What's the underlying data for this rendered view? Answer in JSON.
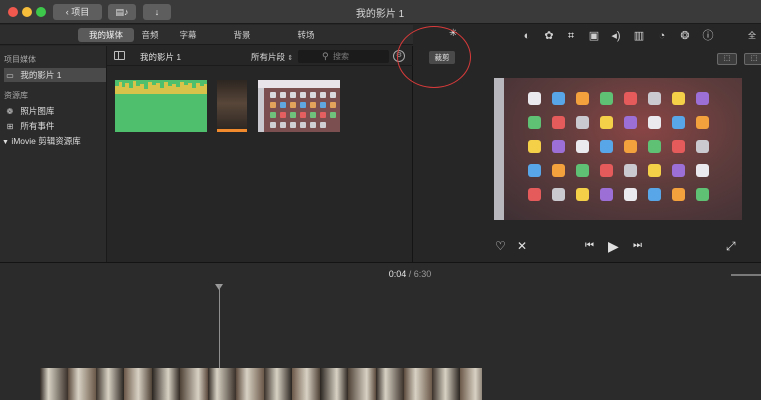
{
  "window": {
    "title": "我的影片 1",
    "back_label": "项目",
    "media_icon": "film-music-icon",
    "import_icon": "down-arrow-icon"
  },
  "tabs": [
    {
      "label": "我的媒体",
      "active": true
    },
    {
      "label": "音频",
      "active": false
    },
    {
      "label": "字幕",
      "active": false
    },
    {
      "label": "背景",
      "active": false
    },
    {
      "label": "转场",
      "active": false
    }
  ],
  "sidebar": {
    "project_header": "项目媒体",
    "project_item": "我的影片 1",
    "library_header": "资源库",
    "library_items": [
      {
        "label": "照片图库",
        "icon": "photos-icon"
      },
      {
        "label": "所有事件",
        "icon": "events-icon"
      }
    ],
    "imovie_library": "iMovie 剪辑资源库"
  },
  "browser": {
    "title": "我的影片 1",
    "filter": "所有片段",
    "search_placeholder": "搜索"
  },
  "viewer": {
    "crop_label": "裁剪",
    "tools_overflow": "全",
    "tools": [
      "color-balance-icon",
      "color-correction-icon",
      "crop-icon",
      "stabilization-icon",
      "volume-icon",
      "noise-reduction-icon",
      "speed-icon",
      "clip-filter-icon",
      "info-icon"
    ],
    "active_tool": "crop-icon"
  },
  "timeline": {
    "current_time": "0:04",
    "separator": "/",
    "total_time": "6:30"
  },
  "colors": {
    "accent_red": "#d83a3a",
    "audio_clip": "#4fbf6d",
    "progress_orange": "#f08a2c"
  }
}
